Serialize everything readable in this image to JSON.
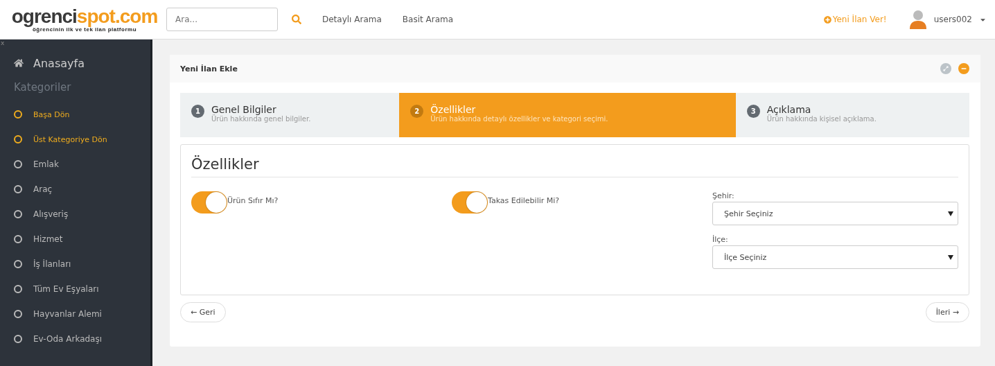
{
  "header": {
    "logo": {
      "dark": "ogrenci",
      "accent": "spot.com",
      "tagline": "öğrencinin ilk ve tek ilan platformu"
    },
    "search": {
      "placeholder": "Ara..."
    },
    "links": [
      "Detaylı Arama",
      "Basit Arama"
    ],
    "new_listing": "Yeni İlan Ver!",
    "user": "users002"
  },
  "sidebar": {
    "close": "x",
    "home": "Anasayfa",
    "section": "Kategoriler",
    "items": [
      {
        "label": "Başa Dön",
        "kind": "nav"
      },
      {
        "label": "Üst Kategoriye Dön",
        "kind": "nav"
      },
      {
        "label": "Emlak",
        "kind": "category"
      },
      {
        "label": "Araç",
        "kind": "category"
      },
      {
        "label": "Alışveriş",
        "kind": "category"
      },
      {
        "label": "Hizmet",
        "kind": "category"
      },
      {
        "label": "İş İlanları",
        "kind": "category"
      },
      {
        "label": "Tüm Ev Eşyaları",
        "kind": "category"
      },
      {
        "label": "Hayvanlar Alemi",
        "kind": "category"
      },
      {
        "label": "Ev-Oda Arkadaşı",
        "kind": "category"
      }
    ]
  },
  "panel": {
    "title": "Yeni İlan Ekle",
    "steps": [
      {
        "number": "1",
        "title": "Genel Bilgiler",
        "subtitle": "Ürün hakkında genel bilgiler.",
        "selected": false
      },
      {
        "number": "2",
        "title": "Özellikler",
        "subtitle": "Ürün hakkında detaylı özellikler ve kategori seçimi.",
        "selected": true
      },
      {
        "number": "3",
        "title": "Açıklama",
        "subtitle": "Ürün hakkında kişisel açıklama.",
        "selected": false
      }
    ],
    "section_title": "Özellikler",
    "toggles": [
      {
        "label": "Ürün Sıfır Mı?",
        "on": true
      },
      {
        "label": "Takas Edilebilir Mi?",
        "on": true
      }
    ],
    "selects": [
      {
        "label": "Şehir:",
        "value": "Şehir Seçiniz"
      },
      {
        "label": "İlçe:",
        "value": "İlçe Seçiniz"
      }
    ],
    "back": "← Geri",
    "next": "İleri →"
  }
}
